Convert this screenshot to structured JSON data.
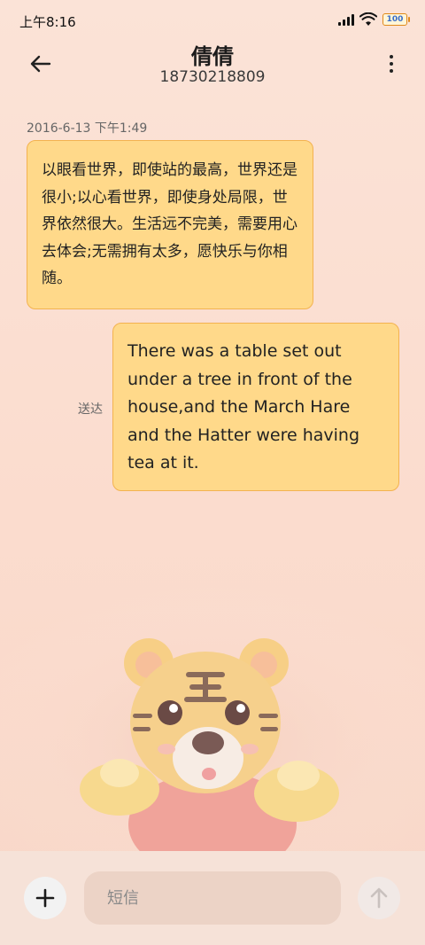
{
  "status_bar": {
    "time": "上午8:16",
    "battery": "100"
  },
  "header": {
    "contact_name": "倩倩",
    "phone_number": "18730218809"
  },
  "messages": [
    {
      "direction": "incoming",
      "timestamp": "2016-6-13 下午1:49",
      "text": "以眼看世界，即使站的最高，世界还是很小;以心看世界，即使身处局限，世界依然很大。生活远不完美，需要用心去体会;无需拥有太多，愿快乐与你相随。"
    },
    {
      "direction": "outgoing",
      "status": "送达",
      "text": "There was a table set out under a tree in front of the house,and the March Hare and the Hatter were having tea at it."
    }
  ],
  "composer": {
    "placeholder": "短信"
  },
  "icons": {
    "back": "arrow-left-icon",
    "more": "more-vertical-icon",
    "add": "plus-icon",
    "send": "arrow-up-icon",
    "wallpaper": "tiger-mascot"
  },
  "colors": {
    "bubble_fill": "#ffd98a",
    "bubble_border": "#f3b24f",
    "background": "#fbe3d7",
    "composer": "#ecd3c6"
  }
}
